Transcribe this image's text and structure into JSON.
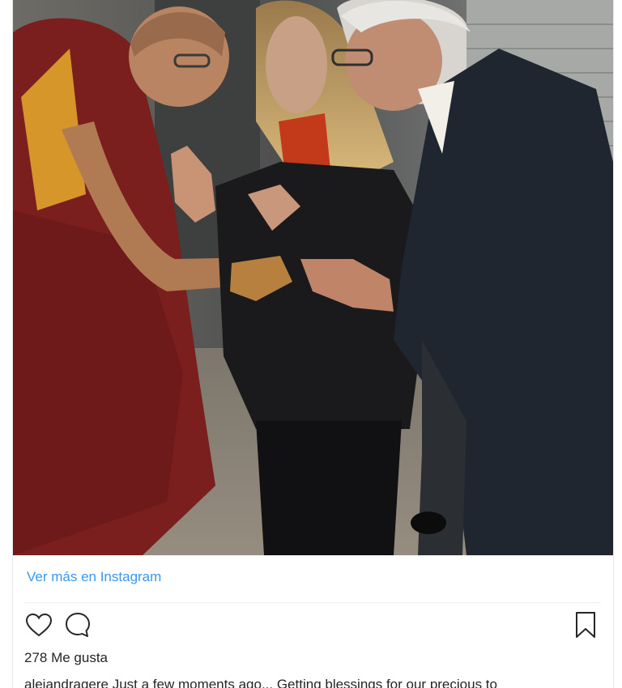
{
  "post": {
    "view_more_label": "Ver más en Instagram",
    "likes_text": "278 Me gusta",
    "caption_text": "alejandragere Just a few moments ago... Getting blessings for our precious to"
  },
  "icons": {
    "like": "heart-icon",
    "comment": "comment-icon",
    "save": "bookmark-icon"
  },
  "colors": {
    "link": "#3897f0",
    "text": "#262626",
    "icon": "#262626"
  }
}
